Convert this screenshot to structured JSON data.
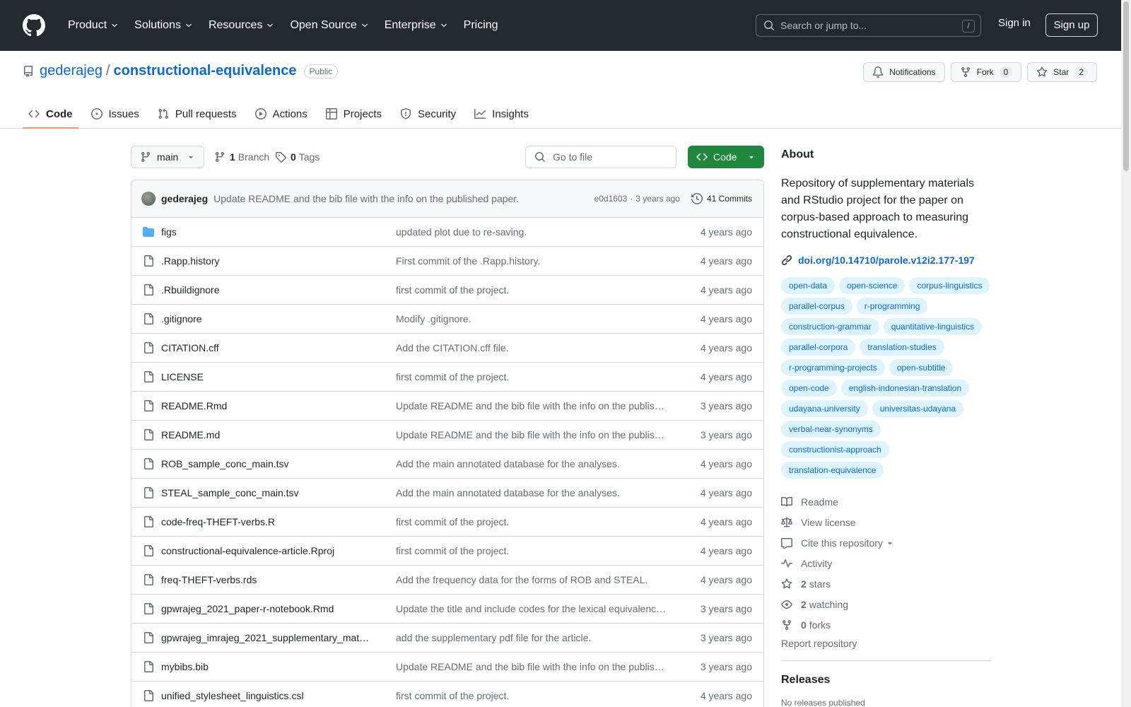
{
  "header": {
    "nav": [
      {
        "label": "Product",
        "dropdown": true
      },
      {
        "label": "Solutions",
        "dropdown": true
      },
      {
        "label": "Resources",
        "dropdown": true
      },
      {
        "label": "Open Source",
        "dropdown": true
      },
      {
        "label": "Enterprise",
        "dropdown": true
      },
      {
        "label": "Pricing",
        "dropdown": false
      }
    ],
    "search_placeholder": "Search or jump to...",
    "search_shortcut": "/",
    "sign_in": "Sign in",
    "sign_up": "Sign up"
  },
  "repo": {
    "owner": "gederajeg",
    "separator": "/",
    "name": "constructional-equivalence",
    "visibility": "Public",
    "notifications_label": "Notifications",
    "fork_label": "Fork",
    "fork_count": "0",
    "star_label": "Star",
    "star_count": "2",
    "tabs": [
      {
        "label": "Code",
        "icon": "code-icon",
        "active": true
      },
      {
        "label": "Issues",
        "icon": "issue-icon",
        "active": false
      },
      {
        "label": "Pull requests",
        "icon": "pull-request-icon",
        "active": false
      },
      {
        "label": "Actions",
        "icon": "play-icon",
        "active": false
      },
      {
        "label": "Projects",
        "icon": "table-icon",
        "active": false
      },
      {
        "label": "Security",
        "icon": "shield-icon",
        "active": false
      },
      {
        "label": "Insights",
        "icon": "graph-icon",
        "active": false
      }
    ]
  },
  "toolbar": {
    "branch": "main",
    "branch_count": "1",
    "branch_label": "Branch",
    "tag_count": "0",
    "tag_label": "Tags",
    "goto_placeholder": "Go to file",
    "code_label": "Code"
  },
  "commit": {
    "author": "gederajeg",
    "message": "Update README and the bib file with the info on the published paper.",
    "hash": "e0d1603",
    "dot": "·",
    "age": "3 years ago",
    "count_label": "41 Commits"
  },
  "files": [
    {
      "name": "figs",
      "type": "folder",
      "message": "updated plot due to re-saving.",
      "age": "4 years ago"
    },
    {
      "name": ".Rapp.history",
      "type": "file",
      "message": "First commit of the .Rapp.history.",
      "age": "4 years ago"
    },
    {
      "name": ".Rbuildignore",
      "type": "file",
      "message": "first commit of the project.",
      "age": "4 years ago"
    },
    {
      "name": ".gitignore",
      "type": "file",
      "message": "Modify .gitignore.",
      "age": "4 years ago"
    },
    {
      "name": "CITATION.cff",
      "type": "file",
      "message": "Add the CITATION.cff file.",
      "age": "4 years ago"
    },
    {
      "name": "LICENSE",
      "type": "file",
      "message": "first commit of the project.",
      "age": "4 years ago"
    },
    {
      "name": "README.Rmd",
      "type": "file",
      "message": "Update README and the bib file with the info on the publis…",
      "age": "3 years ago"
    },
    {
      "name": "README.md",
      "type": "file",
      "message": "Update README and the bib file with the info on the publis…",
      "age": "3 years ago"
    },
    {
      "name": "ROB_sample_conc_main.tsv",
      "type": "file",
      "message": "Add the main annotated database for the analyses.",
      "age": "4 years ago"
    },
    {
      "name": "STEAL_sample_conc_main.tsv",
      "type": "file",
      "message": "Add the main annotated database for the analyses.",
      "age": "4 years ago"
    },
    {
      "name": "code-freq-THEFT-verbs.R",
      "type": "file",
      "message": "first commit of the project.",
      "age": "4 years ago"
    },
    {
      "name": "constructional-equivalence-article.Rproj",
      "type": "file",
      "message": "first commit of the project.",
      "age": "4 years ago"
    },
    {
      "name": "freq-THEFT-verbs.rds",
      "type": "file",
      "message": "Add the frequency data for the forms of ROB and STEAL.",
      "age": "4 years ago"
    },
    {
      "name": "gpwrajeg_2021_paper-r-notebook.Rmd",
      "type": "file",
      "message": "Update the title and include codes for the lexical equivalenc…",
      "age": "3 years ago"
    },
    {
      "name": "gpwrajeg_imrajeg_2021_supplementary_mat…",
      "type": "file",
      "message": "add the supplementary pdf file for the article.",
      "age": "3 years ago"
    },
    {
      "name": "mybibs.bib",
      "type": "file",
      "message": "Update README and the bib file with the info on the publis…",
      "age": "3 years ago"
    },
    {
      "name": "unified_stylesheet_linguistics.csl",
      "type": "file",
      "message": "first commit of the project.",
      "age": "4 years ago"
    }
  ],
  "about": {
    "title": "About",
    "description": "Repository of supplementary materials and RStudio project for the paper on corpus-based approach to measuring constructional equivalence.",
    "link": "doi.org/10.14710/parole.v12i2.177-197",
    "topics": [
      "open-data",
      "open-science",
      "corpus-linguistics",
      "parallel-corpus",
      "r-programming",
      "construction-grammar",
      "quantitative-linguistics",
      "parallel-corpora",
      "translation-studies",
      "r-programming-projects",
      "open-subtitle",
      "open-code",
      "english-indonesian-translation",
      "udayana-university",
      "universitas-udayana",
      "verbal-near-synonyms",
      "constructionist-approach",
      "translation-equivalence"
    ],
    "readme": "Readme",
    "license": "View license",
    "cite": "Cite this repository",
    "activity": "Activity",
    "stars_count": "2",
    "stars_label": "stars",
    "watching_count": "2",
    "watching_label": "watching",
    "forks_count": "0",
    "forks_label": "forks",
    "report": "Report repository"
  },
  "releases": {
    "title": "Releases",
    "subtitle": "No releases published"
  },
  "colors": {
    "header_bg": "#24292f",
    "link": "#0969da",
    "code_button": "#1f883d",
    "topic_bg": "#ddf4ff",
    "active_tab_underline": "#fd8c73"
  }
}
